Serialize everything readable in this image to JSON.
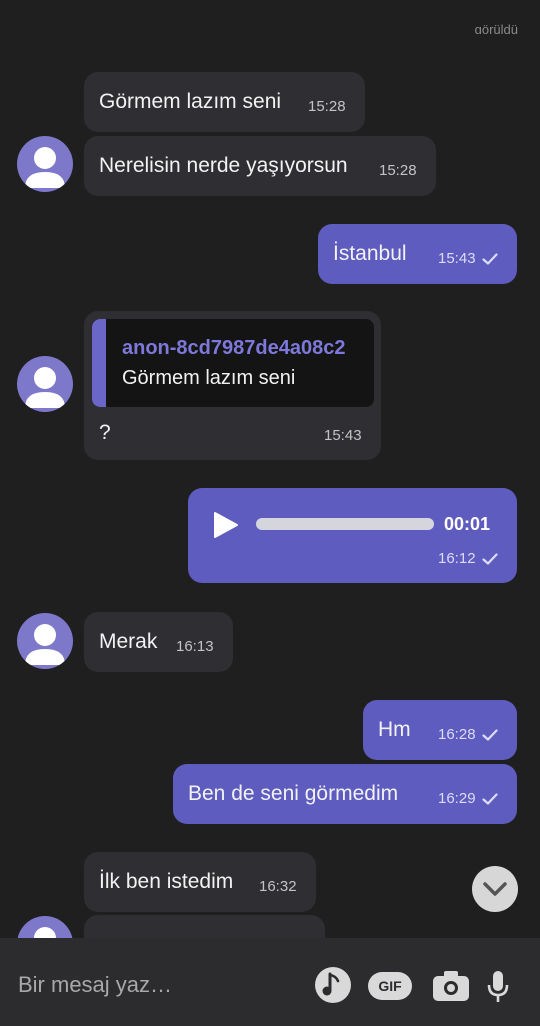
{
  "header": {
    "seen_label": "görüldü"
  },
  "messages": [
    {
      "id": "m1",
      "direction": "in",
      "text": "Görmem lazım seni",
      "time": "15:28"
    },
    {
      "id": "m2",
      "direction": "in",
      "text": "Nerelisin nerde yaşıyorsun",
      "time": "15:28"
    },
    {
      "id": "m3",
      "direction": "out",
      "text": "İstanbul",
      "time": "15:43"
    },
    {
      "id": "m4",
      "direction": "in",
      "reply_to": {
        "author": "anon-8cd7987de4a08c2",
        "text": "Görmem lazım seni"
      },
      "text": "?",
      "time": "15:43"
    },
    {
      "id": "m5",
      "direction": "out",
      "type": "voice",
      "duration": "00:01",
      "time": "16:12"
    },
    {
      "id": "m6",
      "direction": "in",
      "text": "Merak",
      "time": "16:13"
    },
    {
      "id": "m7",
      "direction": "out",
      "text": "Hm",
      "time": "16:28"
    },
    {
      "id": "m8",
      "direction": "out",
      "text": "Ben de seni görmedim",
      "time": "16:29"
    },
    {
      "id": "m9",
      "direction": "in",
      "text": "İlk ben istedim",
      "time": "16:32"
    }
  ],
  "composer": {
    "placeholder": "Bir mesaj yaz…",
    "icons": [
      "sticker-icon",
      "gif-icon",
      "camera-icon",
      "microphone-icon"
    ],
    "gif_label": "GIF"
  },
  "colors": {
    "background": "#1f1f20",
    "incoming": "#2f2f33",
    "outgoing": "#5f5cc0",
    "accent": "#7d78d9"
  }
}
